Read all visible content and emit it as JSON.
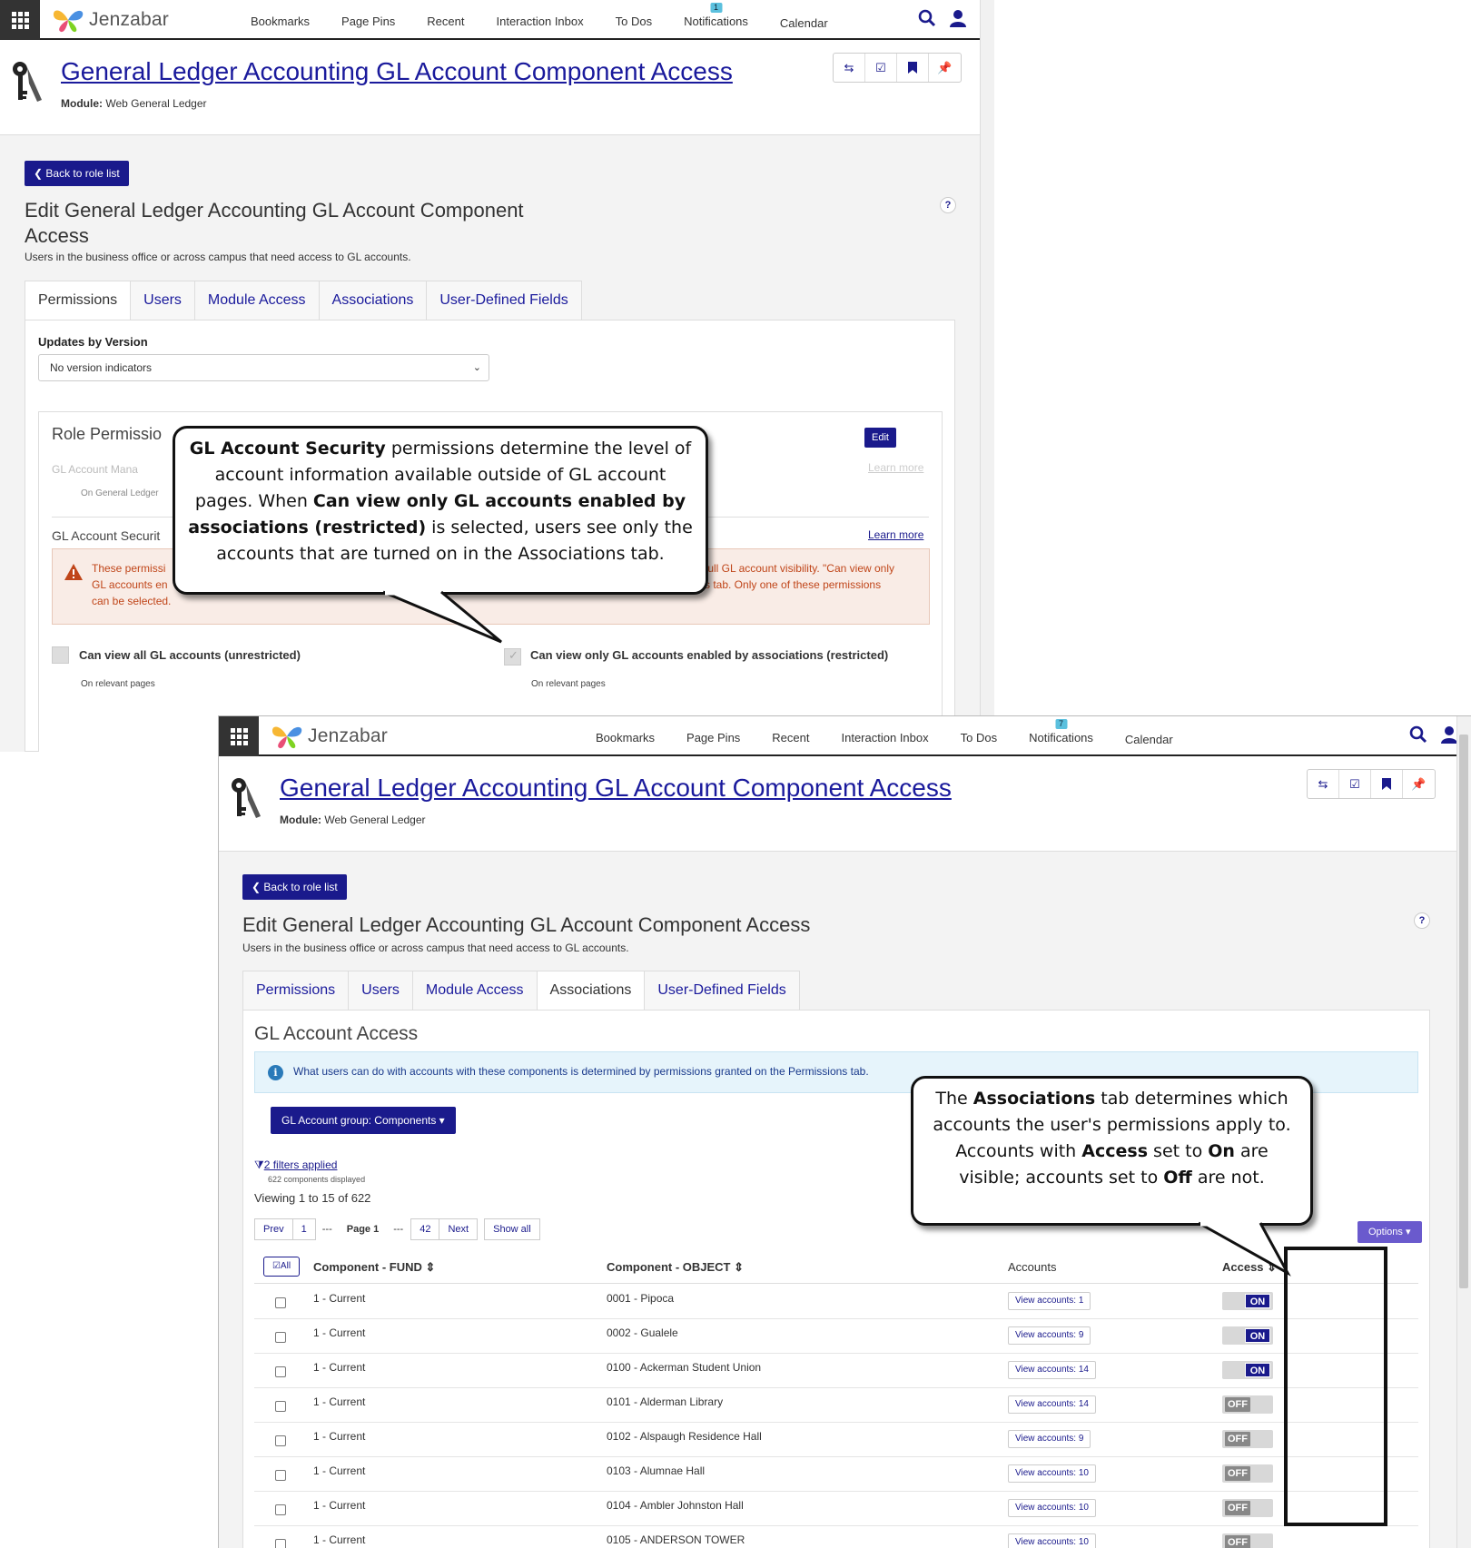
{
  "nav": {
    "brand": "Jenzabar",
    "items": [
      "Bookmarks",
      "Page Pins",
      "Recent",
      "Interaction Inbox",
      "To Dos",
      "Notifications",
      "Calendar"
    ]
  },
  "page": {
    "title": "General Ledger Accounting GL Account Component Access",
    "module_label": "Module:",
    "module_value": "Web General Ledger",
    "back_label": "Back to role list",
    "edit_title_1": "Edit General Ledger Accounting GL Account Component",
    "edit_title_2": "Access",
    "edit_title_full": "Edit General Ledger Accounting GL Account Component Access",
    "subtitle": "Users in the business office or across campus that need access to GL accounts.",
    "tabs": [
      "Permissions",
      "Users",
      "Module Access",
      "Associations",
      "User-Defined Fields"
    ]
  },
  "win1": {
    "notification_count": "1",
    "updates_label": "Updates by Version",
    "updates_value": "No version indicators",
    "role_perm_title": "Role Permissio",
    "gl_mgmt_faded": "GL Account Mana",
    "on_gl_faded": "On General Ledger",
    "edit_label": "Edit",
    "learn_more_faded": "Learn more",
    "gl_security_title": "GL Account Securit",
    "learn_more": "Learn more",
    "warn_left_1": "These permissi",
    "warn_left_2": "GL accounts en",
    "warn_left_3": "can be selected.",
    "warn_right_1": "full GL account visibility. \"Can view only",
    "warn_right_2": "s tab. Only one of these permissions",
    "perm_unrestricted": "Can view all GL accounts (unrestricted)",
    "perm_restricted": "Can view only GL accounts enabled by associations (restricted)",
    "on_relevant": "On relevant pages"
  },
  "callout1": {
    "b1": "GL Account Security",
    "t1": " permissions determine the level of account information available outside of GL account pages. When ",
    "b2": "Can view only GL accounts enabled by associations (restricted)",
    "t2": " is selected, users see only the accounts that are turned on in the Associations tab."
  },
  "win2": {
    "notification_count": "7",
    "section_title": "GL Account Access",
    "info_text": "What users can do with accounts with these components is determined by permissions granted on the Permissions tab.",
    "group_button": "GL Account group: Components",
    "filters_link": "2 filters applied",
    "components_note": "622 components displayed",
    "viewing": "Viewing 1 to 15 of 622",
    "pager": {
      "prev": "Prev",
      "first": "1",
      "dots": "---",
      "page_prefix": "Page",
      "page": "1",
      "last": "42",
      "next": "Next",
      "show_all": "Show all"
    },
    "options": "Options",
    "all_label": "All",
    "columns": [
      "Component - FUND",
      "Component - OBJECT",
      "Accounts",
      "Access"
    ],
    "rows": [
      {
        "fund": "1 - Current",
        "object": "0001 - Pipoca",
        "accounts": "View accounts: 1",
        "access": "ON"
      },
      {
        "fund": "1 - Current",
        "object": "0002 - Gualele",
        "accounts": "View accounts: 9",
        "access": "ON"
      },
      {
        "fund": "1 - Current",
        "object": "0100 - Ackerman Student Union",
        "accounts": "View accounts: 14",
        "access": "ON"
      },
      {
        "fund": "1 - Current",
        "object": "0101 - Alderman Library",
        "accounts": "View accounts: 14",
        "access": "OFF"
      },
      {
        "fund": "1 - Current",
        "object": "0102 - Alspaugh Residence Hall",
        "accounts": "View accounts: 9",
        "access": "OFF"
      },
      {
        "fund": "1 - Current",
        "object": "0103 - Alumnae Hall",
        "accounts": "View accounts: 10",
        "access": "OFF"
      },
      {
        "fund": "1 - Current",
        "object": "0104 - Ambler Johnston Hall",
        "accounts": "View accounts: 10",
        "access": "OFF"
      },
      {
        "fund": "1 - Current",
        "object": "0105 - ANDERSON TOWER",
        "accounts": "View accounts: 10",
        "access": "OFF"
      }
    ]
  },
  "callout2": {
    "t1": "The ",
    "b1": "Associations",
    "t2": " tab determines which accounts the user's permissions apply to. Accounts with ",
    "b2": "Access",
    "t3": " set to ",
    "b3": "On",
    "t4": " are visible; accounts set to ",
    "b4": "Off",
    "t5": " are not."
  },
  "colors": {
    "brand_navy": "#1a1a8c",
    "link": "#1a1a9c",
    "warn_text": "#c0461a",
    "info_bg": "#e6f4fb",
    "options": "#6a5acd",
    "badge": "#5bc0de"
  }
}
